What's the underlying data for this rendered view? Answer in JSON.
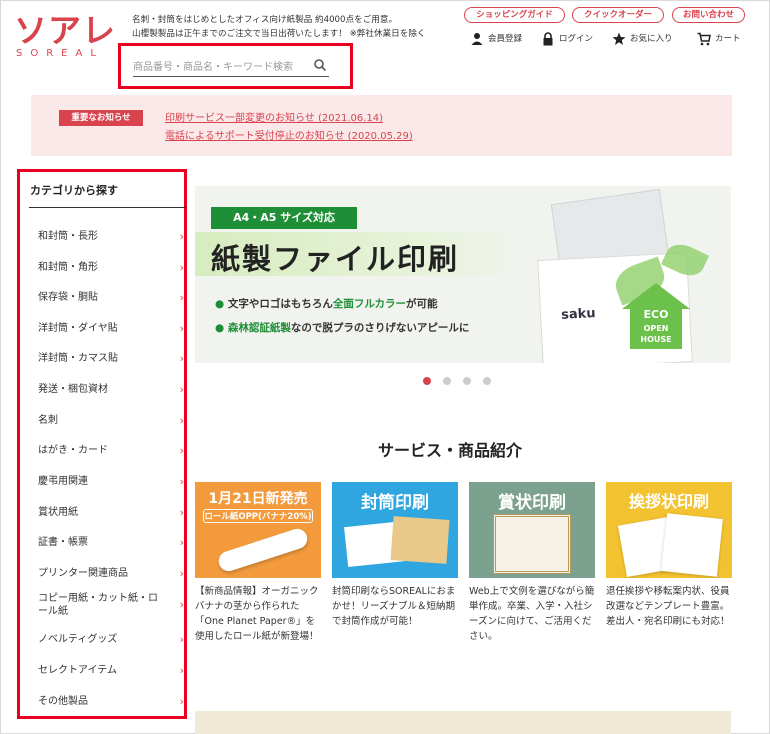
{
  "logo": {
    "main": "ソアレ",
    "sub": "SOREAL"
  },
  "tagline": [
    "名刺・封筒をはじめとしたオフィス向け紙製品 約4000点をご用意。",
    "山櫻製製品は正午までのご注文で当日出荷いたします！ ※弊社休業日を除く"
  ],
  "search": {
    "placeholder": "商品番号・商品名・キーワード検索"
  },
  "top_buttons": [
    "ショッピングガイド",
    "クイックオーダー",
    "お問い合わせ"
  ],
  "user_links": [
    {
      "label": "会員登録",
      "icon": "user-icon"
    },
    {
      "label": "ログイン",
      "icon": "lock-icon"
    },
    {
      "label": "お気に入り",
      "icon": "star-icon"
    },
    {
      "label": "カート",
      "icon": "cart-icon"
    }
  ],
  "notice": {
    "badge": "重要なお知らせ",
    "links": [
      "印刷サービス一部変更のお知らせ (2021.06.14)",
      "電話によるサポート受付停止のお知らせ (2020.05.29)"
    ]
  },
  "sidebar": {
    "title": "カテゴリから探す",
    "items": [
      "和封筒・長形",
      "和封筒・角形",
      "保存袋・胴貼",
      "洋封筒・ダイヤ貼",
      "洋封筒・カマス貼",
      "発送・梱包資材",
      "名刺",
      "はがき・カード",
      "慶弔用関連",
      "賞状用紙",
      "証書・帳票",
      "プリンター関連商品",
      "コピー用紙・カット紙・ロール紙",
      "ノベルティグッズ",
      "セレクトアイテム",
      "その他製品"
    ]
  },
  "banner": {
    "tag": "A4・A5 サイズ対応",
    "title": "紙製ファイル印刷",
    "bullets": [
      {
        "pre": "文字やロゴはもちろん",
        "hl": "全面フルカラー",
        "post": "が可能"
      },
      {
        "pre": "",
        "hl": "森林認証紙製",
        "post": "なので脱プラのさりげないアピールに"
      }
    ],
    "paper_text": "saku",
    "eco_text": [
      "ECO",
      "OPEN",
      "HOUSE"
    ]
  },
  "section_title": "サービス・商品紹介",
  "cards": [
    {
      "head": "1月21日新発売",
      "sub": "ロール紙OPP(バナナ20%)",
      "desc": "【新商品情報】オーガニックバナナの茎から作られた「One Planet Paper®」を使用したロール紙が新登場！"
    },
    {
      "head": "封筒印刷",
      "sub": "",
      "desc": "封筒印刷ならSOREALにおまかせ！リーズナブル＆短納期で封筒作成が可能！"
    },
    {
      "head": "賞状印刷",
      "sub": "",
      "desc": "Web上で文例を選びながら簡単作成。卒業、入学・入社シーズンに向けて、ご活用ください。"
    },
    {
      "head": "挨拶状印刷",
      "sub": "",
      "desc": "退任挨拶や移転案内状、役員改選などテンプレート豊富。差出人・宛名印刷にも対応！"
    }
  ],
  "colors": {
    "brand": "#d9434e",
    "highlight_box": "#e8001e",
    "green": "#1f8f37"
  }
}
